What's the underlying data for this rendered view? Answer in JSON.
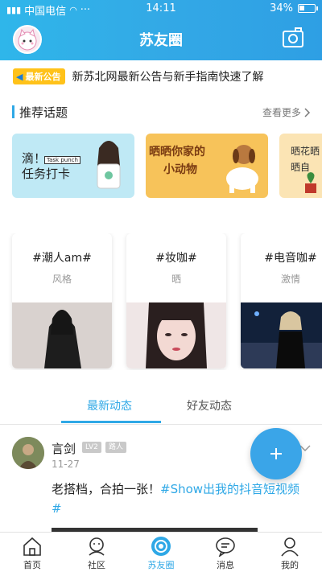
{
  "status_bar": {
    "carrier": "中国电信",
    "time": "14:11",
    "battery": "34%"
  },
  "header": {
    "title": "苏友圈"
  },
  "notice": {
    "badge": "最新公告",
    "text": "新苏北网最新公告与新手指南快速了解"
  },
  "topics_section": {
    "title": "推荐话题",
    "more": "查看更多"
  },
  "banners": [
    {
      "line1": "滴！",
      "line2": "任务打卡",
      "tag": "Task punch"
    },
    {
      "line1": "晒晒你家的",
      "line2": "小动物"
    },
    {
      "line1": "晒花晒",
      "line2": "晒自"
    }
  ],
  "topics": [
    {
      "title": "#潮人am#",
      "subtitle": "风格"
    },
    {
      "title": "#妆咖#",
      "subtitle": "晒"
    },
    {
      "title": "#电音咖#",
      "subtitle": "激情"
    }
  ],
  "feed_tabs": [
    "最新动态",
    "好友动态"
  ],
  "post": {
    "author": "言剑",
    "level": "LV2",
    "role": "路人",
    "date": "11-27",
    "text": "老搭档，合拍一张！",
    "hashtag": "#Show出我的抖音短视频#"
  },
  "bottom_nav": [
    {
      "label": "首页",
      "icon": "home-icon"
    },
    {
      "label": "社区",
      "icon": "community-icon"
    },
    {
      "label": "苏友圈",
      "icon": "circle-icon",
      "active": true
    },
    {
      "label": "消息",
      "icon": "message-icon"
    },
    {
      "label": "我的",
      "icon": "profile-icon"
    }
  ],
  "colors": {
    "primary": "#2fa8e6",
    "notice_badge": "#ffc21a"
  }
}
